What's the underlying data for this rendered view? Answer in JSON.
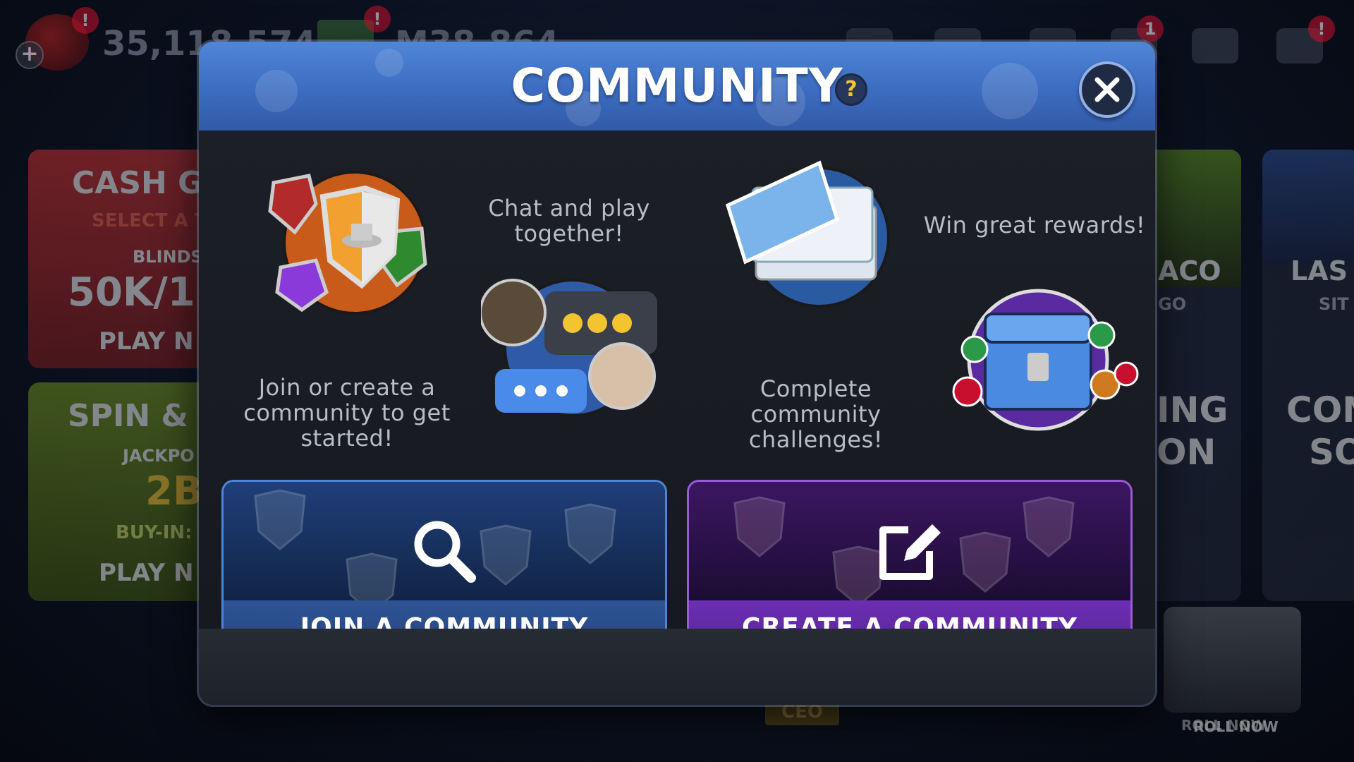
{
  "topbar": {
    "chips_amount": "35,118,574",
    "cash_amount": "M38,864",
    "badge_marker": "!",
    "badge_count": "1",
    "plus_label": "+"
  },
  "background_cards": {
    "cash_game": {
      "title": "CASH G",
      "subtitle": "SELECT A T",
      "blinds_label": "BLINDS",
      "blinds_value": "50K/1",
      "play_label": "PLAY N"
    },
    "spin": {
      "title": "SPIN & ",
      "jackpot_label": "JACKPO",
      "jackpot_value": "2B",
      "buyin_label": "BUY-IN: ",
      "play_label": "PLAY N"
    },
    "monaco": {
      "title": "ACO",
      "subtitle": "GO",
      "bottom1": "ING",
      "bottom2": "ON"
    },
    "las_vegas": {
      "title": "LAS V",
      "subtitle": "SIT",
      "bottom1": "CON",
      "bottom2": "SO"
    },
    "roll_now_label": "ROLL NOW",
    "ceo_label": "CEO"
  },
  "modal": {
    "title": "COMMUNITY",
    "help_symbol": "?",
    "features": {
      "join": "Join or create a community to get started!",
      "chat": "Chat and play together!",
      "challenges": "Complete community challenges!",
      "rewards": "Win great rewards!"
    },
    "join_button_label": "JOIN A COMMUNITY",
    "create_button_label": "CREATE A COMMUNITY"
  },
  "colors": {
    "header_blue": "#3c6cc0",
    "join_blue": "#2f5494",
    "create_purple": "#6b2fb3",
    "alert_red": "#c8102e"
  }
}
